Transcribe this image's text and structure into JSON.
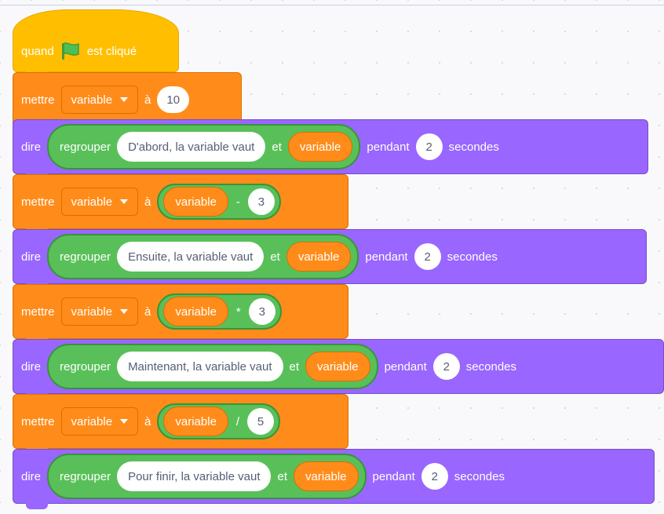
{
  "colors": {
    "events": "#ffbf00",
    "variables": "#ff8c1a",
    "looks": "#9966ff",
    "operators": "#59c059",
    "workspace": "#f9f9fb"
  },
  "hat": {
    "when_label": "quand",
    "flag_icon": "green-flag-icon",
    "clicked_label": "est cliqué"
  },
  "blocks": {
    "b1": {
      "set_label": "mettre",
      "var": "variable",
      "to_label": "à",
      "value": "10"
    },
    "b2": {
      "say_label": "dire",
      "join_label": "regrouper",
      "text": "D'abord, la variable vaut",
      "and_label": "et",
      "var": "variable",
      "for_label": "pendant",
      "secs": "2",
      "secs_label": "secondes"
    },
    "b3": {
      "set_label": "mettre",
      "var": "variable",
      "to_label": "à",
      "op_var": "variable",
      "op": "-",
      "op_num": "3"
    },
    "b4": {
      "say_label": "dire",
      "join_label": "regrouper",
      "text": "Ensuite, la variable vaut",
      "and_label": "et",
      "var": "variable",
      "for_label": "pendant",
      "secs": "2",
      "secs_label": "secondes"
    },
    "b5": {
      "set_label": "mettre",
      "var": "variable",
      "to_label": "à",
      "op_var": "variable",
      "op": "*",
      "op_num": "3"
    },
    "b6": {
      "say_label": "dire",
      "join_label": "regrouper",
      "text": "Maintenant, la variable vaut",
      "and_label": "et",
      "var": "variable",
      "for_label": "pendant",
      "secs": "2",
      "secs_label": "secondes"
    },
    "b7": {
      "set_label": "mettre",
      "var": "variable",
      "to_label": "à",
      "op_var": "variable",
      "op": "/",
      "op_num": "5"
    },
    "b8": {
      "say_label": "dire",
      "join_label": "regrouper",
      "text": "Pour finir, la variable vaut",
      "and_label": "et",
      "var": "variable",
      "for_label": "pendant",
      "secs": "2",
      "secs_label": "secondes"
    }
  }
}
